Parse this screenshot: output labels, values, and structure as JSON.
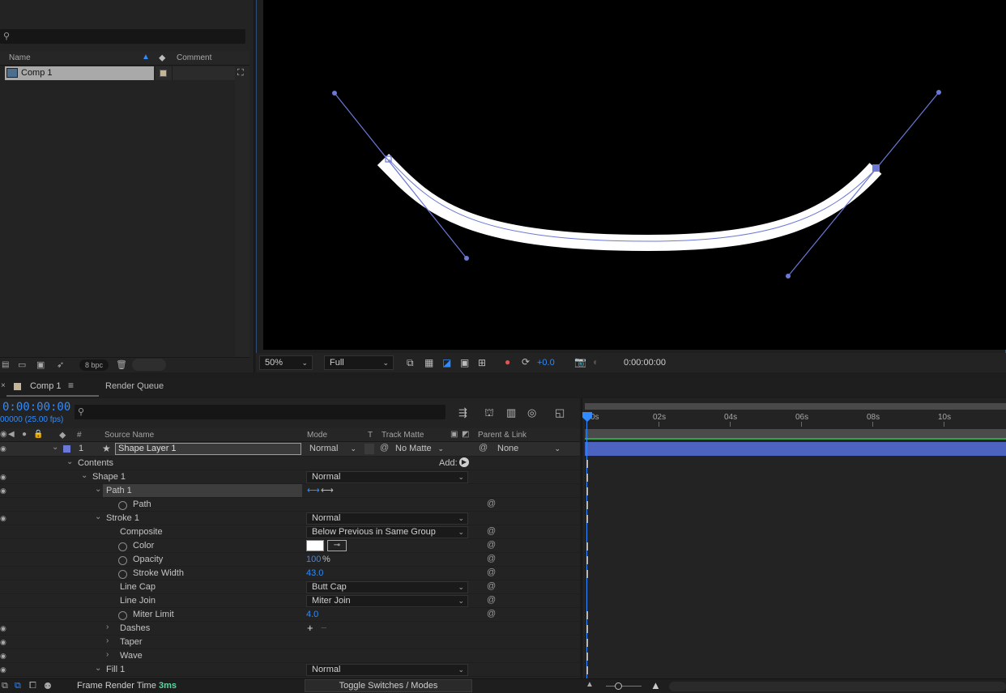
{
  "project": {
    "search_placeholder": "",
    "columns": {
      "name": "Name",
      "comment": "Comment"
    },
    "item": {
      "name": "Comp 1"
    },
    "footer": {
      "bpc": "8 bpc"
    }
  },
  "viewer": {
    "zoom": "50%",
    "resolution": "Full",
    "exposure": "+0.0",
    "timecode": "0:00:00:00"
  },
  "timeline": {
    "tabs": {
      "comp": "Comp 1",
      "render_queue": "Render Queue"
    },
    "timecode": "0:00:00:00",
    "fps": "00000 (25.00 fps)",
    "columns": {
      "num": "#",
      "source_name": "Source Name",
      "mode": "Mode",
      "t": "T",
      "track_matte": "Track Matte",
      "parent": "Parent & Link"
    },
    "ruler": [
      "0s",
      "02s",
      "04s",
      "06s",
      "08s",
      "10s"
    ],
    "layer": {
      "number": "1",
      "name": "Shape Layer 1",
      "mode": "Normal",
      "track_matte": "No Matte",
      "parent": "None"
    },
    "contents_label": "Contents",
    "add_label": "Add:",
    "rows": {
      "shape": {
        "label": "Shape 1",
        "mode": "Normal"
      },
      "path_group": {
        "label": "Path 1"
      },
      "path": {
        "label": "Path"
      },
      "stroke": {
        "label": "Stroke 1",
        "mode": "Normal"
      },
      "composite": {
        "label": "Composite",
        "value": "Below Previous in Same Group"
      },
      "color": {
        "label": "Color"
      },
      "opacity": {
        "label": "Opacity",
        "value": "100",
        "unit": "%"
      },
      "stroke_width": {
        "label": "Stroke Width",
        "value": "43.0"
      },
      "line_cap": {
        "label": "Line Cap",
        "value": "Butt Cap"
      },
      "line_join": {
        "label": "Line Join",
        "value": "Miter Join"
      },
      "miter_limit": {
        "label": "Miter Limit",
        "value": "4.0"
      },
      "dashes": {
        "label": "Dashes"
      },
      "taper": {
        "label": "Taper"
      },
      "wave": {
        "label": "Wave"
      },
      "fill": {
        "label": "Fill 1",
        "mode": "Normal"
      }
    },
    "footer": {
      "render_time_label": "Frame Render Time",
      "render_time_value": "3ms",
      "toggle": "Toggle Switches / Modes"
    }
  },
  "colors": {
    "accent_blue": "#2f8bff",
    "layer_bar": "#4d63c0",
    "label_swatch": "#c7b597",
    "handle": "#6b78d6"
  }
}
